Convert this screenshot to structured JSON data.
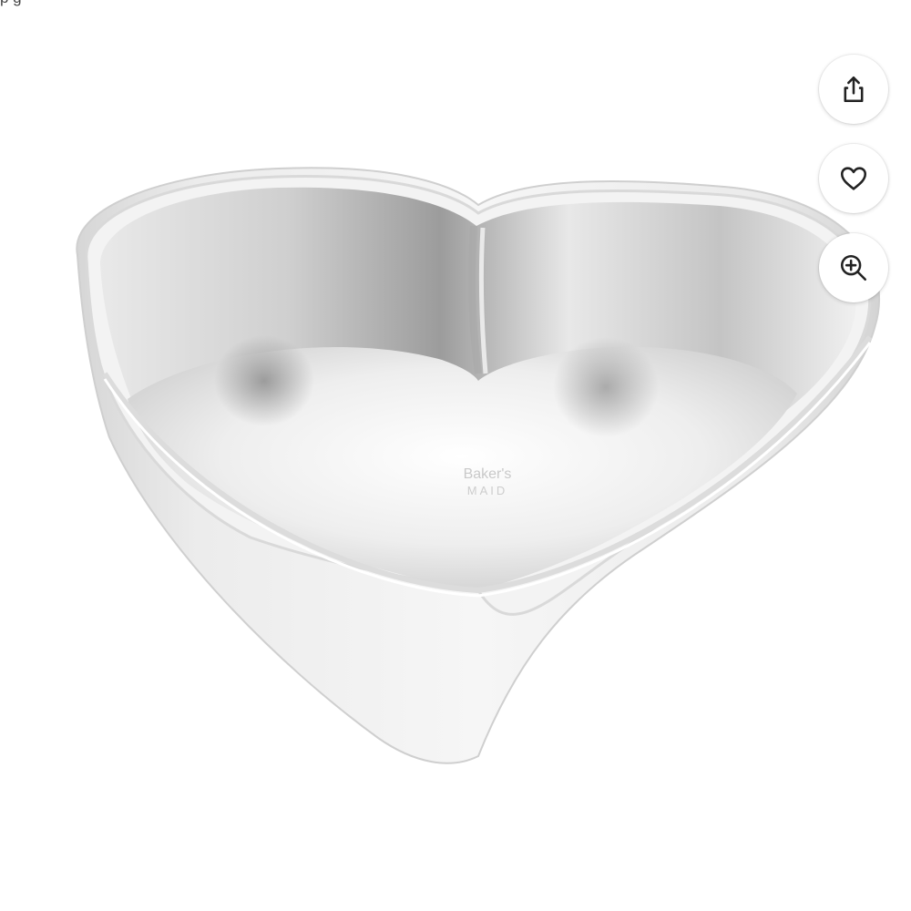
{
  "header": {
    "snippet": "p           g"
  },
  "product": {
    "image_subject": "heart-shaped aluminum cake pan",
    "embossed_text_line1": "Baker's",
    "embossed_text_line2": "MAID"
  },
  "actions": {
    "share_icon": "share-icon",
    "favorite_icon": "heart-outline-icon",
    "zoom_icon": "zoom-in-icon"
  },
  "colors": {
    "background": "#ffffff",
    "icon_stroke": "#222222",
    "pan_light": "#f2f2f2",
    "pan_mid": "#d8d8d8",
    "pan_dark": "#a9a9a9"
  }
}
